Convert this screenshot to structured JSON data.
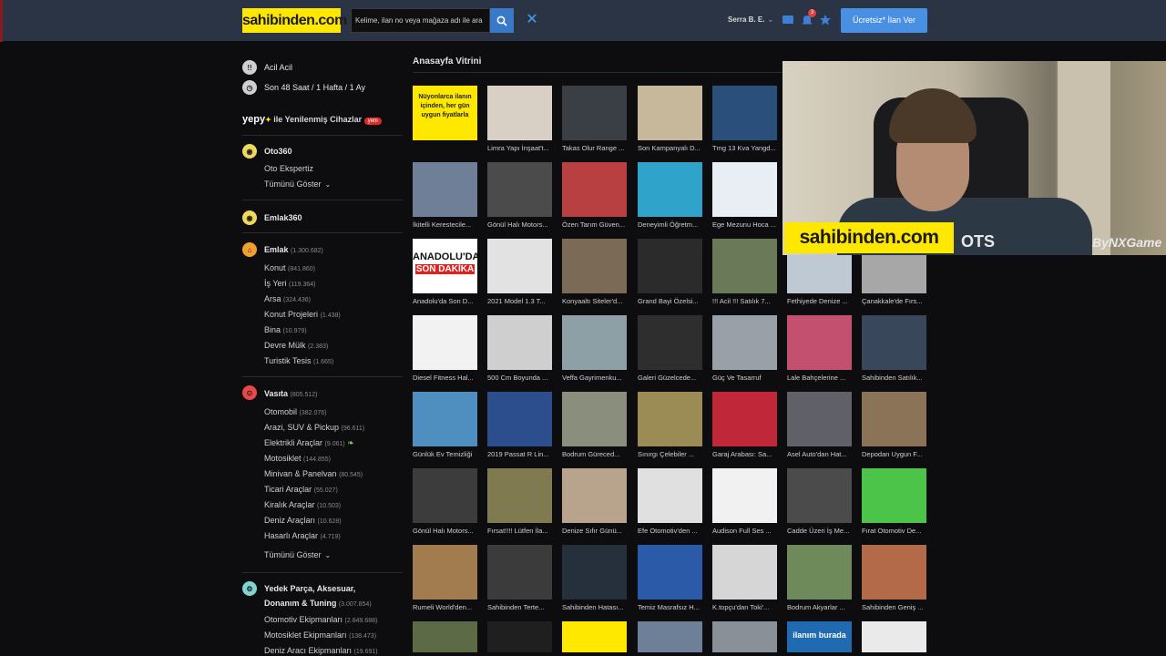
{
  "header": {
    "logo": "sahibinden.com",
    "search_placeholder": "Kelime, ilan no veya mağaza adı ile ara",
    "clear_label": "✕",
    "user_name": "Serra B. E.",
    "notif_count": "3",
    "post_button": "Ücretsiz* İlan Ver"
  },
  "sidebar": {
    "acil": "Acil Acil",
    "son48": "Son 48 Saat",
    "slash1": " / ",
    "hafta": "1 Hafta",
    "slash2": " / ",
    "ay": "1 Ay",
    "yepy_logo": "yepy",
    "yepy_label": " ile Yenilenmiş Cihazlar",
    "yeni": "yeni",
    "oto360": "Oto360",
    "oto_ekspertiz": "Oto Ekspertiz",
    "tumu1": "Tümünü Göster",
    "emlak360": "Emlak360",
    "emlak": {
      "label": "Emlak",
      "count": "(1.300.682)"
    },
    "emlak_items": [
      {
        "label": "Konut",
        "count": "(841.860)"
      },
      {
        "label": "İş Yeri",
        "count": "(119.364)"
      },
      {
        "label": "Arsa",
        "count": "(324.436)"
      },
      {
        "label": "Konut Projeleri",
        "count": "(1.438)"
      },
      {
        "label": "Bina",
        "count": "(10.979)"
      },
      {
        "label": "Devre Mülk",
        "count": "(2.383)"
      },
      {
        "label": "Turistik Tesis",
        "count": "(1.665)"
      }
    ],
    "vasita": {
      "label": "Vasıta",
      "count": "(805.512)"
    },
    "vasita_items": [
      {
        "label": "Otomobil",
        "count": "(382.076)"
      },
      {
        "label": "Arazi, SUV & Pickup",
        "count": "(96.611)"
      },
      {
        "label": "Elektrikli Araçlar",
        "count": "(9.061)"
      },
      {
        "label": "Motosiklet",
        "count": "(144.855)"
      },
      {
        "label": "Minivan & Panelvan",
        "count": "(80.545)"
      },
      {
        "label": "Ticari Araçlar",
        "count": "(55.027)"
      },
      {
        "label": "Kiralık Araçlar",
        "count": "(10.503)"
      },
      {
        "label": "Deniz Araçları",
        "count": "(10.628)"
      },
      {
        "label": "Hasarlı Araçlar",
        "count": "(4.719)"
      }
    ],
    "tumu2": "Tümünü Göster",
    "yedek_line1": "Yedek Parça, Aksesuar,",
    "yedek_line2": "Donanım & Tuning",
    "yedek_count": "(3.007.854)",
    "yedek_items": [
      {
        "label": "Otomotiv Ekipmanları",
        "count": "(2.849.688)"
      },
      {
        "label": "Motosiklet Ekipmanları",
        "count": "(138.473)"
      },
      {
        "label": "Deniz Aracı Ekipmanları",
        "count": "(19.691)"
      }
    ]
  },
  "vitrin": {
    "title": "Anasayfa Vitrini",
    "promo_text": "Nüyonlarca ilanın içinden, her gün uygun fiyatlarla",
    "anadolu_line1": "ANADOLU'DA",
    "anadolu_line2": "SON DAKİKA",
    "rows": [
      [
        "",
        "Limra Yapı İnşaat't...",
        "Takas Olur Range ...",
        "Son Kampanyalı D...",
        "Tmg 13 Kva Yangd..."
      ],
      [
        "İkitelli Kerestecile...",
        "Gönül Halı Motors...",
        "Özen Tarım Güven...",
        "Deneyimli Öğretm...",
        "Ege Mezunu Hoca ..."
      ],
      [
        "Anadolu'da Son D...",
        "2021 Model 1.3 T...",
        "Konyaaltı Siteler'd...",
        "Grand Bayi Özelsi...",
        "!!! Acil !!! Satılık 7...",
        "Fethiyede Denize ...",
        "Çanakkale'de Fırs..."
      ],
      [
        "Diesel Fitness Hal...",
        "500 Cm Boyunda ...",
        "Veffa Gayrimenku...",
        "Galeri Güzelcede...",
        "Güç Ve Tasarruf",
        "Lale Bahçelerine ...",
        "Sahibinden Satılık..."
      ],
      [
        "Günlük Ev Temizliği",
        "2019 Passat R Lin...",
        "Bodrum Güreced...",
        "Sınırgı Çelebiler ...",
        "Garaj Arabası: Sa...",
        "Asel Auto'dan Hat...",
        "Depodan Uygun F..."
      ],
      [
        "Gönül Halı Motors...",
        "Fırsat!!!! Lütfen İla...",
        "Denize Sıfır Günü...",
        "Efe Otomotiv'den ...",
        "Audison Full Ses ...",
        "Cadde Üzeri İş Me...",
        "Fırat Otomotiv De..."
      ],
      [
        "Rumeli World'den...",
        "Sahibinden Terte...",
        "Sahibinden Hatası...",
        "Temiz Masrafsız H...",
        "K.topçu'dan Toki'...",
        "Bodrum Akyarlar ...",
        "Sahibinden Geniş ..."
      ]
    ],
    "thumb_colors": [
      [
        "#ffe800",
        "#d8d0c4",
        "#3a3f46",
        "#c7b79b",
        "#2a4f7a"
      ],
      [
        "#6f7f98",
        "#4b4b4b",
        "#b84040",
        "#2fa3c9",
        "#e9eef5"
      ],
      [
        "#ffffff",
        "#e2e2e2",
        "#7b6a55",
        "#2b2b2b",
        "#6a7a58",
        "#bfc9d3",
        "#a7a7a7"
      ],
      [
        "#f2f2f2",
        "#cfcfcf",
        "#8da0a6",
        "#2e2e2e",
        "#9aa0a8",
        "#c45070",
        "#39475a"
      ],
      [
        "#4f8fbf",
        "#2c4e8c",
        "#8a8f7d",
        "#9b8b55",
        "#c0283a",
        "#5f6068",
        "#8a7356"
      ],
      [
        "#3c3c3c",
        "#7f7a50",
        "#b8a48d",
        "#e0e0e0",
        "#f1f1f1",
        "#4b4b4b",
        "#4cc44a"
      ],
      [
        "#a27c4e",
        "#3b3b3b",
        "#26303c",
        "#2a5aa8",
        "#d6d6d6",
        "#6f8a5a",
        "#b26a48"
      ],
      [
        "#5c6b46",
        "#1f1f1f",
        "#ffe800",
        "#6e7f98",
        "#8a9097",
        "#1f6ab0",
        "#eaeaea"
      ]
    ],
    "last_row_promo": "ilanım burada"
  },
  "webcam": {
    "badge": "sahibinden.com",
    "shirt_text": "OTS",
    "watermark": "ByNXGame"
  },
  "colors": {
    "header_bg": "#2b3444",
    "logo_yellow": "#ffe800",
    "accent_blue": "#4a90e2"
  }
}
